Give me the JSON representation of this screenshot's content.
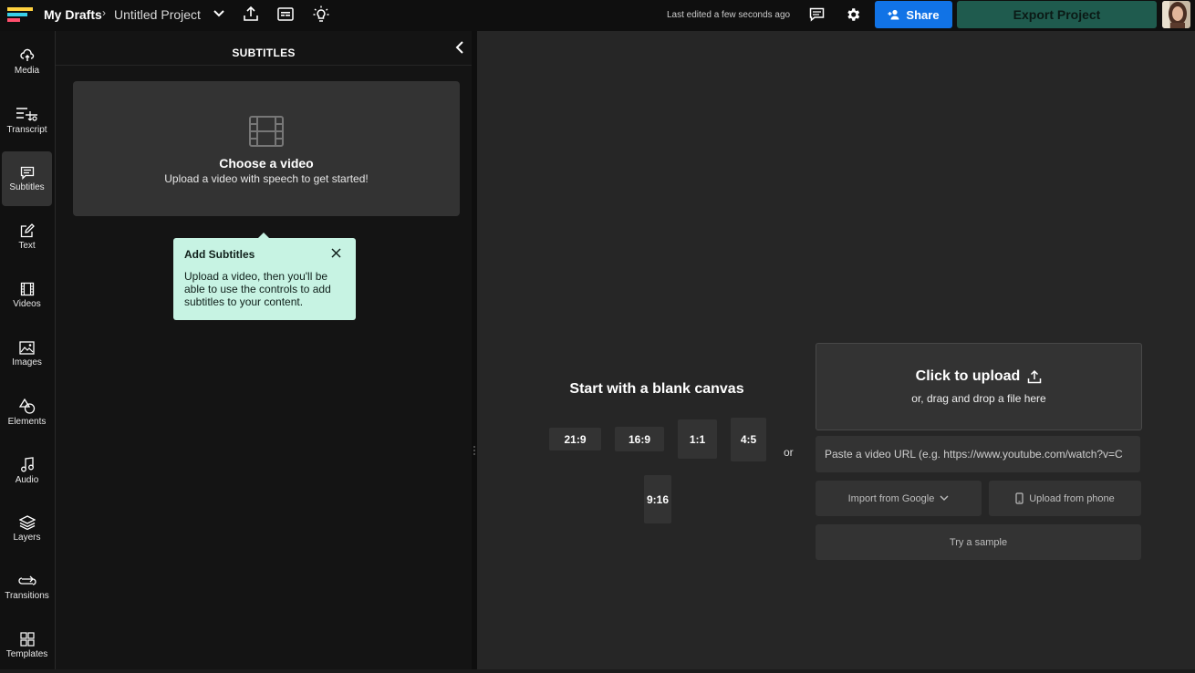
{
  "topbar": {
    "breadcrumb_root": "My Drafts",
    "breadcrumb_sep": "›",
    "project_name": "Untitled Project",
    "last_edited": "Last edited a few seconds ago",
    "share_label": "Share",
    "export_label": "Export Project"
  },
  "sidebar": {
    "items": [
      {
        "label": "Media",
        "icon": "upload-cloud-icon"
      },
      {
        "label": "Transcript",
        "icon": "transcript-icon"
      },
      {
        "label": "Subtitles",
        "icon": "subtitles-icon"
      },
      {
        "label": "Text",
        "icon": "text-edit-icon"
      },
      {
        "label": "Videos",
        "icon": "film-icon"
      },
      {
        "label": "Images",
        "icon": "image-icon"
      },
      {
        "label": "Elements",
        "icon": "shapes-icon"
      },
      {
        "label": "Audio",
        "icon": "music-note-icon"
      },
      {
        "label": "Layers",
        "icon": "layers-icon"
      },
      {
        "label": "Transitions",
        "icon": "transitions-icon"
      },
      {
        "label": "Templates",
        "icon": "grid-icon"
      }
    ]
  },
  "panel": {
    "title": "SUBTITLES",
    "choose_title": "Choose a video",
    "choose_sub": "Upload a video with speech to get started!",
    "tooltip_title": "Add Subtitles",
    "tooltip_body": "Upload a video, then you'll be able to use the controls to add subtitles to your content."
  },
  "canvas": {
    "blank_heading": "Start with a blank canvas",
    "ratios": [
      "21:9",
      "16:9",
      "1:1",
      "4:5",
      "9:16"
    ],
    "or_label": "or",
    "upload_title": "Click to upload",
    "upload_sub": "or, drag and drop a file here",
    "url_placeholder": "Paste a video URL (e.g. https://www.youtube.com/watch?v=C",
    "import_google": "Import from Google",
    "upload_phone": "Upload from phone",
    "try_sample": "Try a sample"
  },
  "colors": {
    "share_bg": "#1173e6",
    "export_bg": "#1f5b4e",
    "tooltip_bg": "#c7f3e3"
  }
}
